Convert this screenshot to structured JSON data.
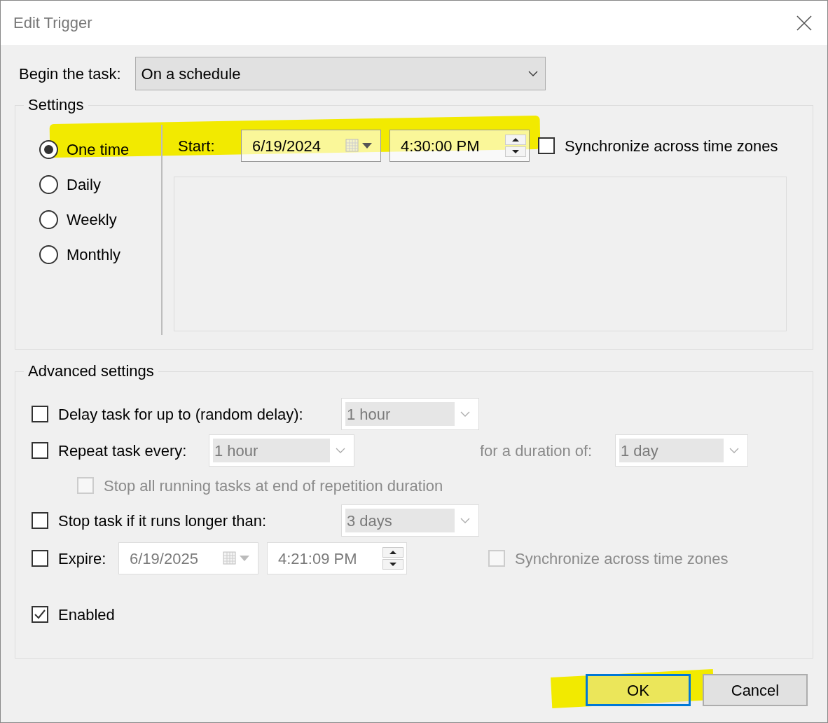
{
  "window": {
    "title": "Edit Trigger"
  },
  "begin": {
    "label": "Begin the task:",
    "value": "On a schedule"
  },
  "settings": {
    "title": "Settings",
    "schedules": [
      {
        "label": "One time",
        "selected": true
      },
      {
        "label": "Daily",
        "selected": false
      },
      {
        "label": "Weekly",
        "selected": false
      },
      {
        "label": "Monthly",
        "selected": false
      }
    ],
    "start": {
      "label": "Start:",
      "date": "6/19/2024",
      "time": "4:30:00 PM"
    },
    "sync": {
      "label": "Synchronize across time zones",
      "checked": false
    }
  },
  "advanced": {
    "title": "Advanced settings",
    "delay": {
      "label": "Delay task for up to (random delay):",
      "checked": false,
      "value": "1 hour",
      "disabled": true
    },
    "repeat": {
      "label": "Repeat task every:",
      "checked": false,
      "value": "1 hour",
      "disabled": true,
      "duration_label": "for a duration of:",
      "duration": "1 day"
    },
    "stop_all": {
      "label": "Stop all running tasks at end of repetition duration",
      "checked": false,
      "disabled": true
    },
    "stop_task": {
      "label": "Stop task if it runs longer than:",
      "checked": false,
      "value": "3 days",
      "disabled": true
    },
    "expire": {
      "label": "Expire:",
      "checked": false,
      "date": "6/19/2025",
      "time": "4:21:09 PM",
      "disabled": true,
      "sync": {
        "label": "Synchronize across time zones",
        "checked": false,
        "disabled": true
      }
    },
    "enabled": {
      "label": "Enabled",
      "checked": true
    }
  },
  "buttons": [
    {
      "label": "OK",
      "default": true
    },
    {
      "label": "Cancel",
      "default": false
    }
  ]
}
